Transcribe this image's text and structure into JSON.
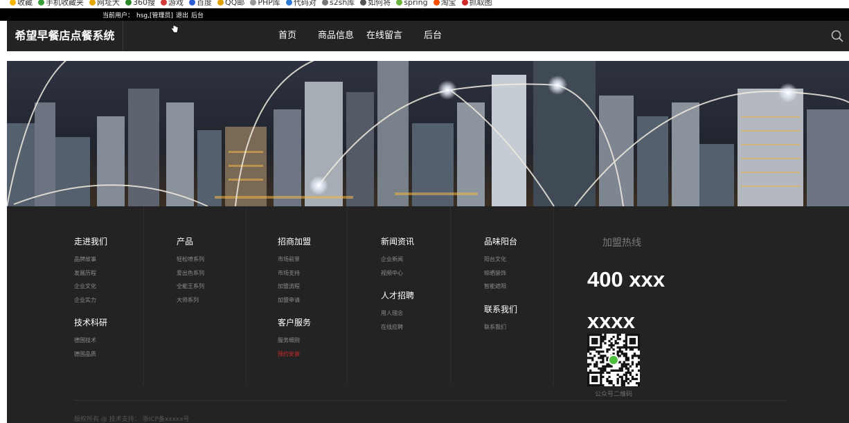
{
  "browser": {
    "bookmarks": [
      {
        "label": "收藏",
        "color": "#f5b400"
      },
      {
        "label": "手机收藏夹",
        "color": "#3aa03a"
      },
      {
        "label": "网址大",
        "color": "#e6a800"
      },
      {
        "label": "360搜",
        "color": "#2a8a2a"
      },
      {
        "label": "游戏",
        "color": "#d23b3b"
      },
      {
        "label": "百度",
        "color": "#2e5fd6"
      },
      {
        "label": "QQ邮",
        "color": "#e0a200"
      },
      {
        "label": "PHP库",
        "color": "#999999"
      },
      {
        "label": "代码对",
        "color": "#2a7ad6"
      },
      {
        "label": "s2sh库",
        "color": "#777777"
      },
      {
        "label": "如何将",
        "color": "#555555"
      },
      {
        "label": "spring",
        "color": "#6db33f"
      },
      {
        "label": "淘宝",
        "color": "#ff5000"
      },
      {
        "label": "抓取图",
        "color": "#d02a2a"
      }
    ]
  },
  "userbar": {
    "prefix": "当前用户：",
    "user": "hsg,[管理员]",
    "logout": "退出",
    "admin": "后台"
  },
  "header": {
    "brand": "希望早餐店点餐系统",
    "nav": [
      "首页",
      "商品信息",
      "在线留言",
      "后台"
    ],
    "search_icon": "search-icon"
  },
  "footer": {
    "columns": [
      {
        "title": "走进我们",
        "items": [
          "品牌故事",
          "发展历程",
          "企业文化",
          "企业实力"
        ],
        "sub_title": "技术科研",
        "sub_items": [
          "德国技术",
          "德国品质"
        ]
      },
      {
        "title": "产品",
        "items": [
          "轻松喷系列",
          "爱出色系列",
          "全能王系列",
          "大师系列"
        ]
      },
      {
        "title": "招商加盟",
        "items": [
          "市场前景",
          "市场支持",
          "加盟流程",
          "加盟申请"
        ],
        "sub_title": "客户服务",
        "sub_items": [
          "服务细则",
          "预约安装"
        ]
      },
      {
        "title": "新闻资讯",
        "items": [
          "企业新闻",
          "视频中心"
        ],
        "sub_title": "人才招聘",
        "sub_items": [
          "用人理念",
          "在线应聘"
        ]
      },
      {
        "title": "品味阳台",
        "items": [
          "阳台文化",
          "晾晒装饰",
          "智能遮阳"
        ],
        "sub_title": "联系我们",
        "sub_items": [
          "联系我们"
        ]
      }
    ],
    "hotline": {
      "title": "加盟热线",
      "number_line1": "400 xxx",
      "number_line2": "xxxx",
      "qr_label": "公众号二维码"
    },
    "copyright": "版权所有 @ 技术支持：  浙ICP备xxxxx号"
  }
}
